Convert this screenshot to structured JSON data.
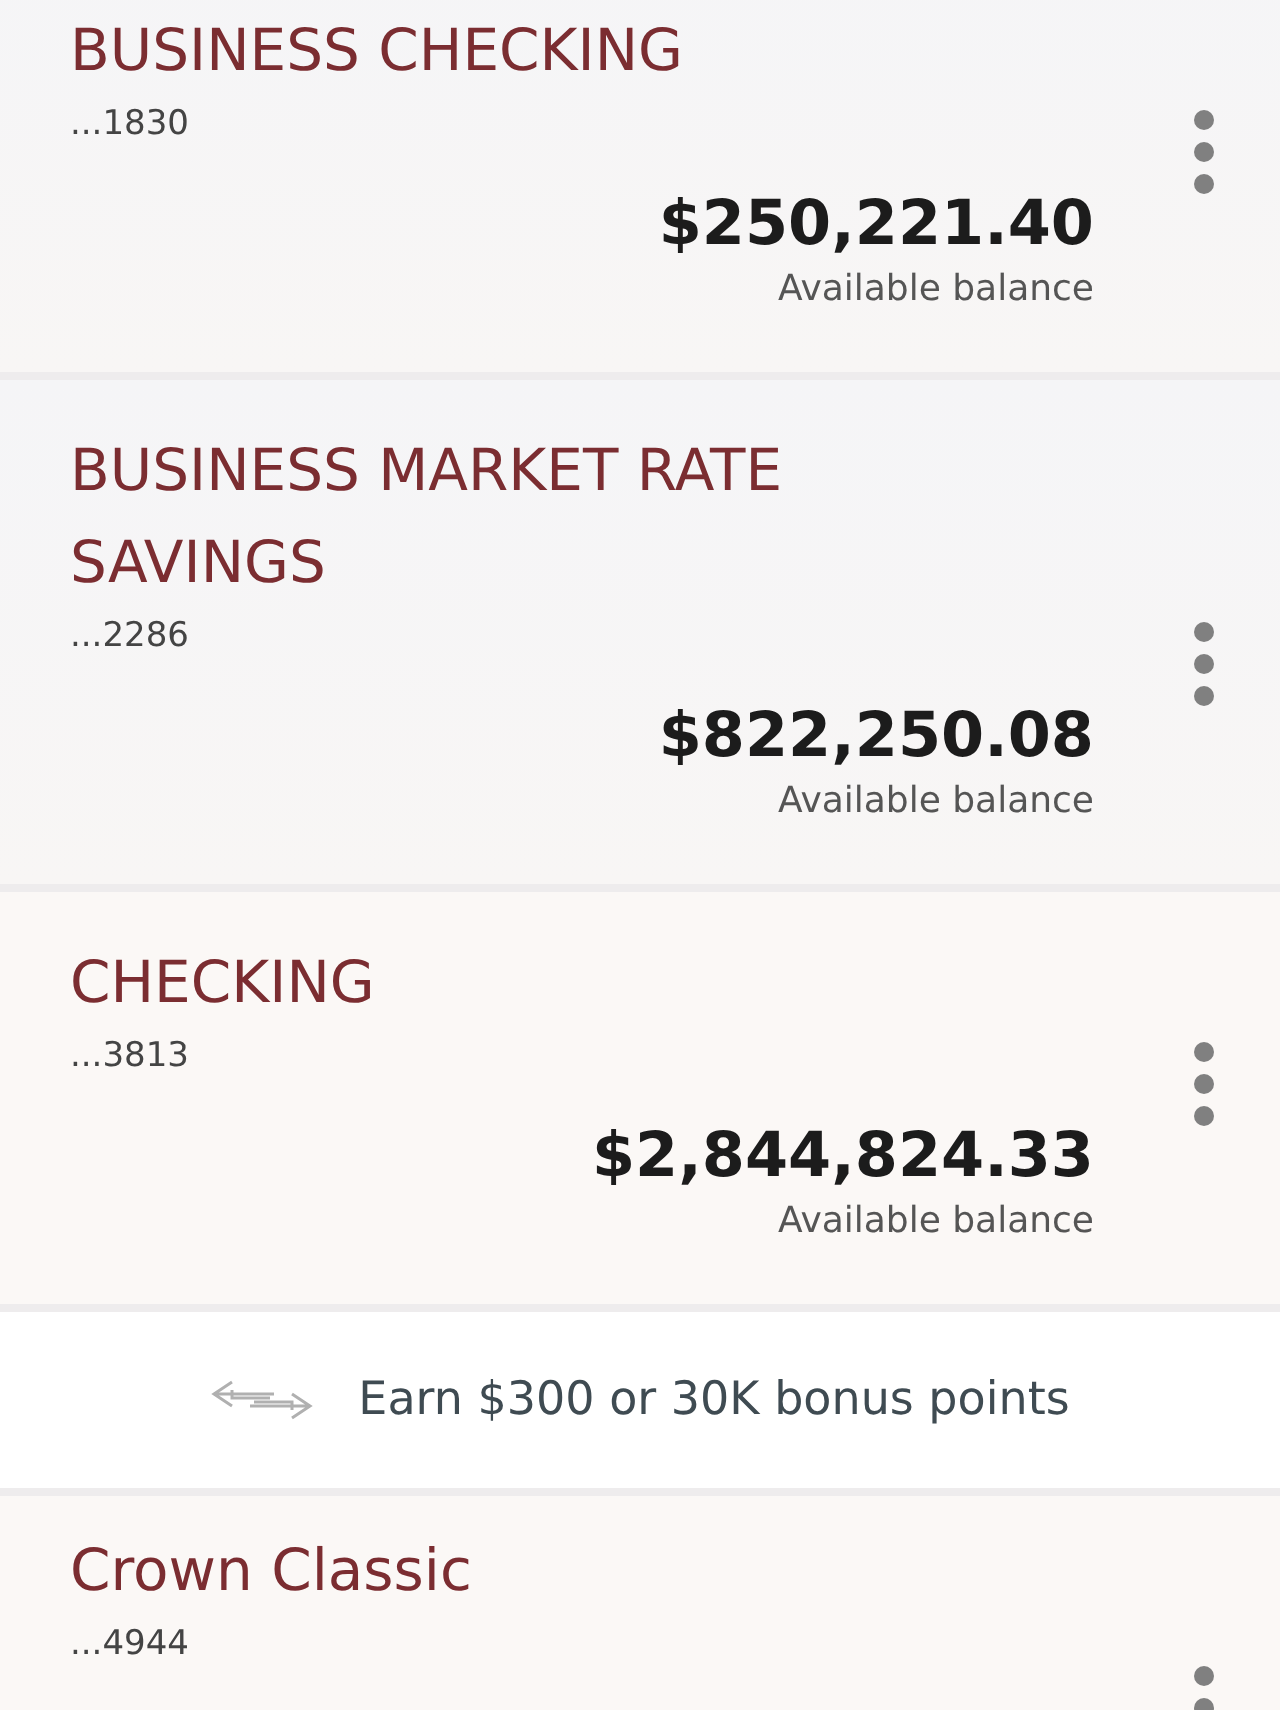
{
  "accounts": [
    {
      "name": "BUSINESS CHECKING",
      "number": "...1830",
      "balance": "$250,221.40",
      "balance_label": "Available balance"
    },
    {
      "name": "BUSINESS MARKET RATE SAVINGS",
      "number": "...2286",
      "balance": "$822,250.08",
      "balance_label": "Available balance"
    },
    {
      "name": "CHECKING",
      "number": "...3813",
      "balance": "$2,844,824.33",
      "balance_label": "Available balance"
    }
  ],
  "promo": {
    "text": "Earn $300 or 30K bonus points"
  },
  "more_accounts": [
    {
      "name": "Crown Classic",
      "number": "...4944"
    }
  ]
}
